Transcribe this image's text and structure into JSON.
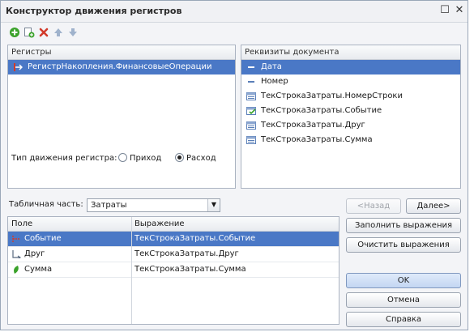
{
  "window": {
    "title": "Конструктор движения регистров"
  },
  "titlebar": {
    "maximize": "☐",
    "close": "✕"
  },
  "toolbar": {
    "icons": [
      "add-icon",
      "copy-icon",
      "delete-icon",
      "move-up-icon",
      "move-down-icon"
    ]
  },
  "registers": {
    "header": "Регистры",
    "items": [
      "РегистрНакопления.ФинансовыеОперации"
    ],
    "movement_label": "Тип движения регистра:",
    "options": [
      "Приход",
      "Расход"
    ],
    "selected_option": "Расход"
  },
  "attributes": {
    "header": "Реквизиты документа",
    "items": [
      {
        "label": "Дата",
        "icon": "field-dash-icon"
      },
      {
        "label": "Номер",
        "icon": "field-dash-icon"
      },
      {
        "label": "ТекСтрокаЗатраты.НомерСтроки",
        "icon": "table-field-icon"
      },
      {
        "label": "ТекСтрокаЗатраты.Событие",
        "icon": "table-field-check-icon"
      },
      {
        "label": "ТекСтрокаЗатраты.Друг",
        "icon": "table-field-icon"
      },
      {
        "label": "ТекСтрокаЗатраты.Сумма",
        "icon": "table-field-icon"
      }
    ],
    "selected_index": 0
  },
  "tabular": {
    "label": "Табличная часть:",
    "value": "Затраты"
  },
  "nav": {
    "back": "<Назад",
    "next": "Далее>"
  },
  "grid": {
    "columns": [
      "Поле",
      "Выражение"
    ],
    "rows": [
      {
        "field": "Событие",
        "expression": "ТекСтрокаЗатраты.Событие",
        "icon": "dimension-icon"
      },
      {
        "field": "Друг",
        "expression": "ТекСтрокаЗатраты.Друг",
        "icon": "link-icon"
      },
      {
        "field": "Сумма",
        "expression": "ТекСтрокаЗатраты.Сумма",
        "icon": "resource-icon"
      }
    ],
    "selected_index": 0
  },
  "actions": {
    "fill": "Заполнить выражения",
    "clear": "Очистить выражения",
    "ok": "OK",
    "cancel": "Отмена",
    "help": "Справка"
  },
  "colors": {
    "selection": "#4a78c6",
    "accent_green": "#3aa22a",
    "accent_red": "#d23a2a"
  }
}
